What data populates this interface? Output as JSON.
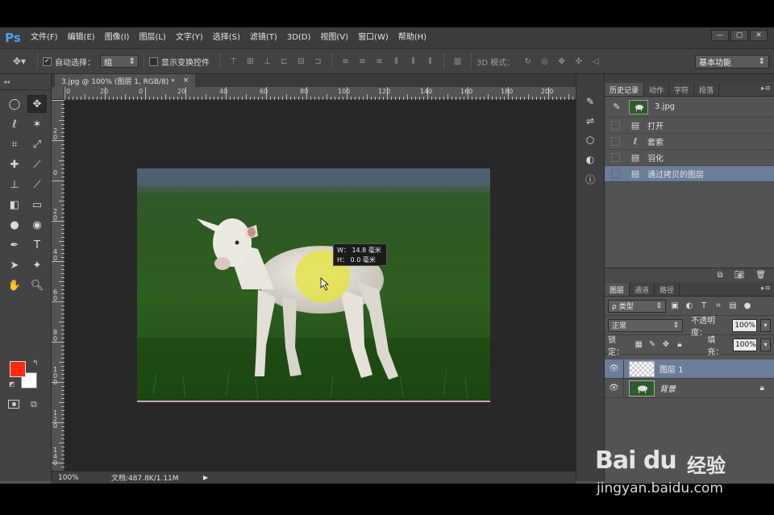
{
  "app": {
    "logo": "Ps"
  },
  "menu": [
    "文件(F)",
    "编辑(E)",
    "图像(I)",
    "图层(L)",
    "文字(Y)",
    "选择(S)",
    "滤镜(T)",
    "3D(D)",
    "视图(V)",
    "窗口(W)",
    "帮助(H)"
  ],
  "window_controls": {
    "minimize": "—",
    "restore": "▢",
    "close": "✕"
  },
  "options": {
    "auto_select_label": "自动选择：",
    "auto_select_checked": true,
    "auto_select_value": "组",
    "show_transform_label": "显示变换控件",
    "show_transform_checked": false,
    "mode_3d_label": "3D 模式：",
    "workspace": "基本功能"
  },
  "document": {
    "tab_title": "3.jpg @ 100% (图层 1, RGB/8) *",
    "tab_close": "×",
    "zoom": "100%",
    "doc_info": "文档:487.8K/1.11M"
  },
  "rulers": {
    "top": [
      "0",
      "20",
      "0",
      "20",
      "40",
      "60",
      "80",
      "100",
      "120",
      "140",
      "160",
      "180",
      "200"
    ],
    "left": [
      "2",
      "0",
      "0",
      "2",
      "0",
      "4",
      "0",
      "6",
      "0",
      "8",
      "0",
      "1",
      "0",
      "0",
      "1",
      "2",
      "0",
      "1",
      "4",
      "0"
    ]
  },
  "measure_tip": {
    "w": "W： 14.8 毫米",
    "h": "H： 0.0 毫米"
  },
  "colors": {
    "foreground": "#ff2a13",
    "background": "#ffffff",
    "selection_highlight": "#6a7d99"
  },
  "history_panel": {
    "tabs": [
      "历史记录",
      "动作",
      "字符",
      "段落"
    ],
    "snapshot_name": "3.jpg",
    "steps": [
      {
        "label": "打开",
        "icon": "document-icon"
      },
      {
        "label": "套索",
        "icon": "lasso-icon"
      },
      {
        "label": "羽化",
        "icon": "document-icon"
      },
      {
        "label": "通过拷贝的图层",
        "icon": "document-icon",
        "selected": true
      }
    ]
  },
  "layers_panel": {
    "tabs": [
      "图层",
      "通道",
      "路径"
    ],
    "filter_label": "ρ 类型",
    "blend_mode": "正常",
    "opacity_label": "不透明度：",
    "opacity_value": "100%",
    "lock_label": "锁定：",
    "fill_label": "填充：",
    "fill_value": "100%",
    "layers": [
      {
        "name": "图层 1",
        "selected": true,
        "transparent": true
      },
      {
        "name": "背景",
        "selected": false,
        "locked": true,
        "italic": true
      }
    ]
  },
  "watermark": {
    "brand": "Bai du",
    "jingyan": "经验",
    "url": "jingyan.baidu.com"
  }
}
